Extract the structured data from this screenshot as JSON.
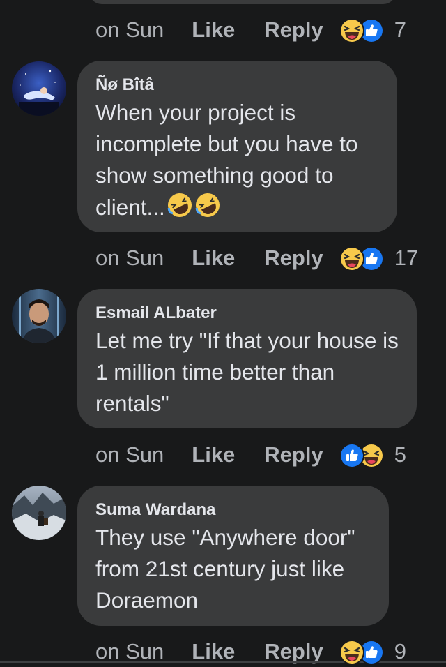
{
  "comments": [
    {
      "author": "",
      "text": "",
      "time": "on Sun",
      "like_label": "Like",
      "reply_label": "Reply",
      "reactions": [
        "laughing-emoji",
        "thumbs-up-emoji"
      ],
      "reaction_count": "7"
    },
    {
      "author": "Ñø Bîtâ",
      "text": "When your project is incomplete but you have to show something good to client...",
      "time": "on Sun",
      "like_label": "Like",
      "reply_label": "Reply",
      "reactions": [
        "laughing-emoji",
        "thumbs-up-emoji"
      ],
      "reaction_count": "17"
    },
    {
      "author": "Esmail ALbater",
      "text": "Let me try \"If that your house is 1 million time better than rentals\"",
      "time": "on Sun",
      "like_label": "Like",
      "reply_label": "Reply",
      "reactions": [
        "thumbs-up-emoji",
        "laughing-emoji"
      ],
      "reaction_count": "5"
    },
    {
      "author": "Suma Wardana",
      "text": "They use \"Anywhere door\" from 21st century just like Doraemon",
      "time": "on Sun",
      "like_label": "Like",
      "reply_label": "Reply",
      "reactions": [
        "laughing-emoji",
        "thumbs-up-emoji"
      ],
      "reaction_count": "9"
    }
  ],
  "colors": {
    "background": "#18191a",
    "bubble": "#3a3b3c",
    "primary_text": "#e4e6eb",
    "secondary_text": "#b0b3b8",
    "like_blue": "#1877f2",
    "haha_yellow": "#f7c94b"
  }
}
